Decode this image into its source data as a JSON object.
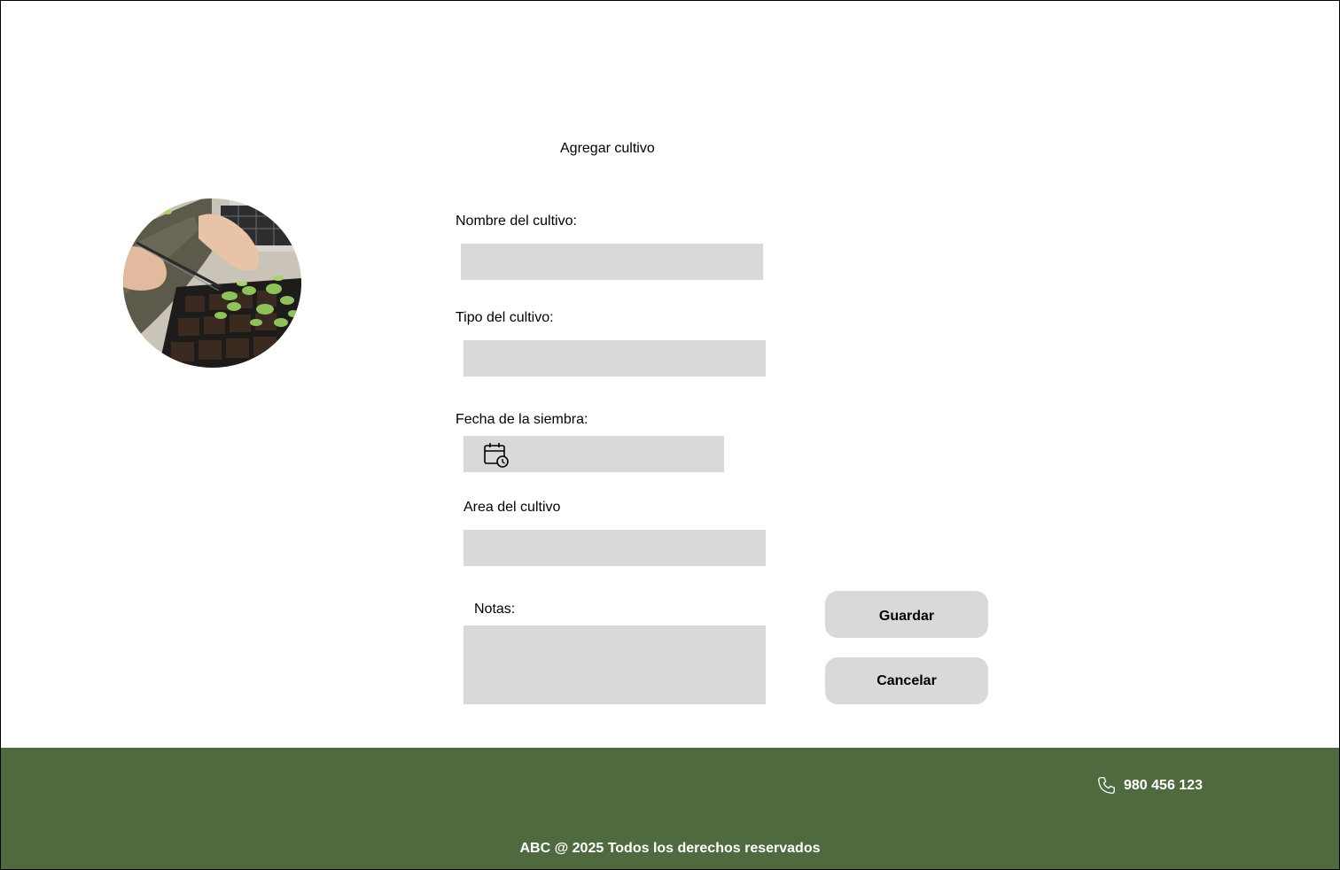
{
  "page": {
    "title": "Agregar cultivo"
  },
  "image": {
    "description_icon": "seedling-tray-photo"
  },
  "form": {
    "nombre": {
      "label": "Nombre del cultivo:",
      "value": "",
      "placeholder": ""
    },
    "tipo": {
      "label": "Tipo del cultivo:",
      "value": "",
      "placeholder": ""
    },
    "fecha": {
      "label": "Fecha de la siembra:",
      "value": "",
      "placeholder": "",
      "icon": "calendar-clock-icon"
    },
    "area": {
      "label": "Area del cultivo",
      "value": "",
      "placeholder": ""
    },
    "notas": {
      "label": "Notas:",
      "value": "",
      "placeholder": ""
    }
  },
  "actions": {
    "save_label": "Guardar",
    "cancel_label": "Cancelar"
  },
  "footer": {
    "phone_icon": "phone-icon",
    "phone": "980 456 123",
    "copyright": "ABC @ 2025 Todos los derechos reservados"
  },
  "colors": {
    "footer_bg": "#4f6a3f",
    "field_bg": "#d9d9d9",
    "button_bg": "#d9d9d9"
  }
}
